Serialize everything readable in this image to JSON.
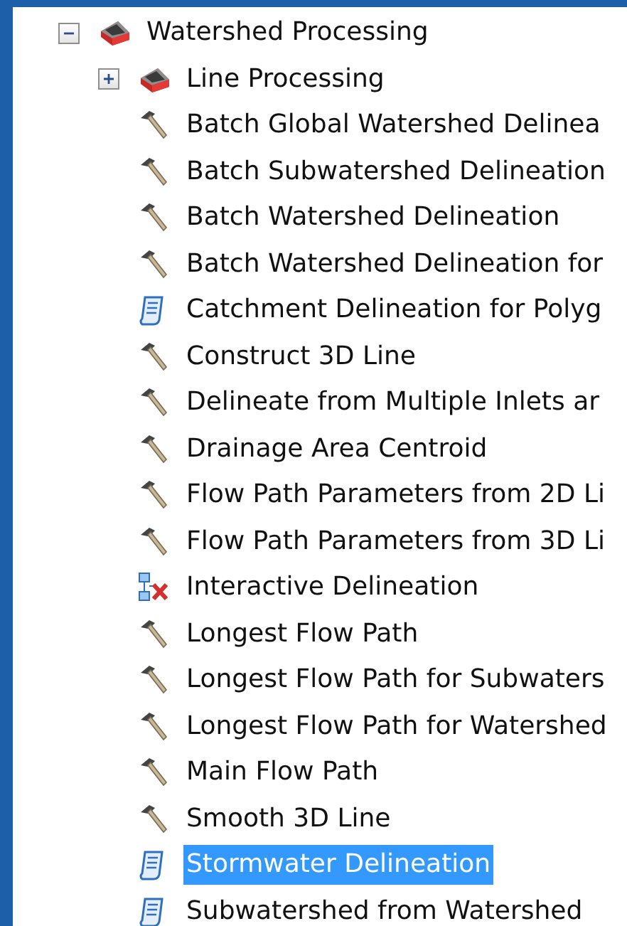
{
  "tree": [
    {
      "label": "Watershed Processing",
      "kind": "toolbox",
      "expanded": true,
      "selected": false,
      "children": [
        {
          "label": "Line Processing",
          "kind": "toolbox",
          "expanded": false,
          "selected": false
        },
        {
          "label": "Batch Global Watershed Delinea",
          "kind": "tool",
          "selected": false
        },
        {
          "label": "Batch Subwatershed Delineation",
          "kind": "tool",
          "selected": false
        },
        {
          "label": "Batch Watershed Delineation",
          "kind": "tool",
          "selected": false
        },
        {
          "label": "Batch Watershed Delineation for",
          "kind": "tool",
          "selected": false
        },
        {
          "label": "Catchment Delineation for Polyg",
          "kind": "script",
          "selected": false
        },
        {
          "label": "Construct 3D Line",
          "kind": "tool",
          "selected": false
        },
        {
          "label": "Delineate from Multiple Inlets ar",
          "kind": "tool",
          "selected": false
        },
        {
          "label": "Drainage Area Centroid",
          "kind": "tool",
          "selected": false
        },
        {
          "label": "Flow Path Parameters from 2D Li",
          "kind": "tool",
          "selected": false
        },
        {
          "label": "Flow Path Parameters from 3D Li",
          "kind": "tool",
          "selected": false
        },
        {
          "label": "Interactive Delineation",
          "kind": "model",
          "selected": false
        },
        {
          "label": "Longest Flow Path",
          "kind": "tool",
          "selected": false
        },
        {
          "label": "Longest Flow Path for Subwaters",
          "kind": "tool",
          "selected": false
        },
        {
          "label": "Longest Flow Path for Watershed",
          "kind": "tool",
          "selected": false
        },
        {
          "label": "Main Flow Path",
          "kind": "tool",
          "selected": false
        },
        {
          "label": "Smooth 3D Line",
          "kind": "tool",
          "selected": false
        },
        {
          "label": "Stormwater Delineation",
          "kind": "script",
          "selected": true
        },
        {
          "label": "Subwatershed from Watershed",
          "kind": "script",
          "selected": false
        }
      ]
    }
  ]
}
